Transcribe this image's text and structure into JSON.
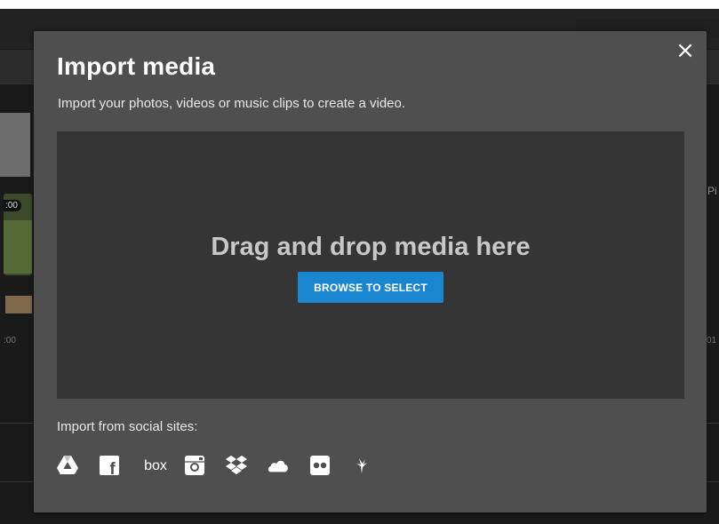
{
  "modal": {
    "title": "Import media",
    "subtitle": "Import your photos, videos or music clips to create a video.",
    "close_label": "×",
    "dropzone": {
      "text": "Drag and drop media here",
      "browse_label": "BROWSE TO SELECT"
    },
    "social": {
      "label": "Import from social sites:",
      "sources": [
        {
          "name": "google-drive",
          "icon": "google-drive-icon"
        },
        {
          "name": "facebook",
          "icon": "facebook-icon",
          "glyph": "f"
        },
        {
          "name": "box",
          "icon": "box-icon",
          "glyph": "box"
        },
        {
          "name": "instagram",
          "icon": "instagram-icon"
        },
        {
          "name": "dropbox",
          "icon": "dropbox-icon"
        },
        {
          "name": "onedrive",
          "icon": "onedrive-icon"
        },
        {
          "name": "flickr",
          "icon": "flickr-icon"
        },
        {
          "name": "other",
          "icon": "bird-icon"
        }
      ]
    }
  },
  "background": {
    "video_time": ":00",
    "time_left": ":00",
    "time_right": "01",
    "side_text": "Pi"
  },
  "colors": {
    "modal_bg": "#4f4f4f",
    "dropzone_bg": "#353535",
    "accent": "#1a86cf",
    "app_bg": "#1a1a1a"
  }
}
